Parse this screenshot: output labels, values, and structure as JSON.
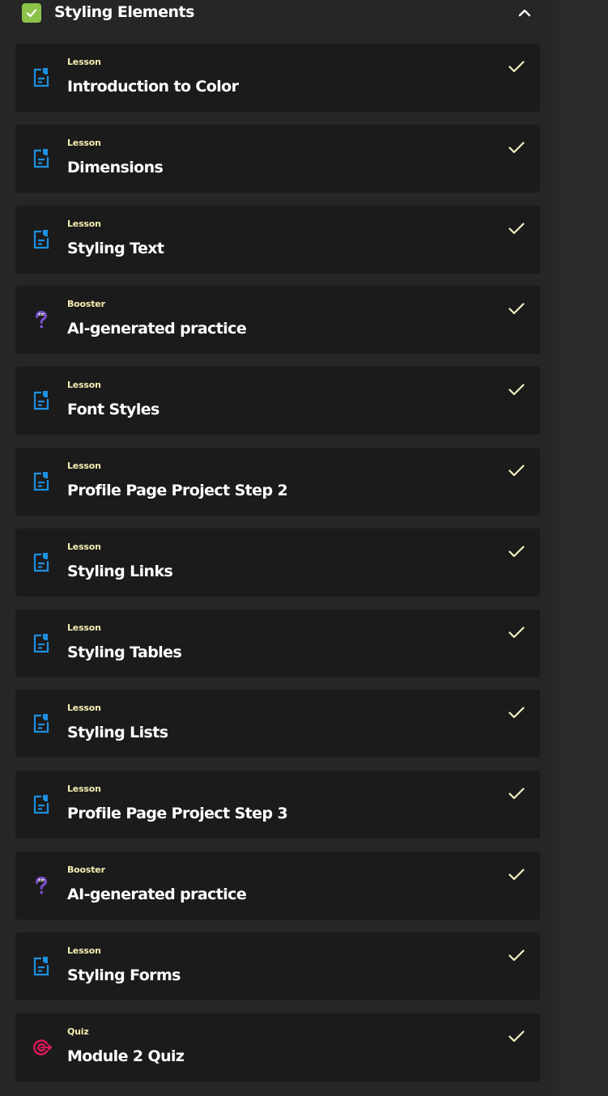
{
  "module": {
    "title": "Styling Elements",
    "completed": true,
    "collapse_icon": "chevron-up-icon",
    "accent_color": "#8bc34a"
  },
  "colors": {
    "lesson_icon": "#1e90e0",
    "booster_icon": "#7b4fd0",
    "quiz_icon": "#e0195a",
    "type_label": "#f5eeb0",
    "check": "#f5f0c0"
  },
  "items": [
    {
      "type": "Lesson",
      "title": "Introduction to Color",
      "icon": "lesson-icon",
      "completed": true
    },
    {
      "type": "Lesson",
      "title": "Dimensions",
      "icon": "lesson-icon",
      "completed": true
    },
    {
      "type": "Lesson",
      "title": "Styling Text",
      "icon": "lesson-icon",
      "completed": true
    },
    {
      "type": "Booster",
      "title": "AI-generated practice",
      "icon": "booster-icon",
      "completed": true
    },
    {
      "type": "Lesson",
      "title": "Font Styles",
      "icon": "lesson-icon",
      "completed": true
    },
    {
      "type": "Lesson",
      "title": "Profile Page Project Step 2",
      "icon": "lesson-icon",
      "completed": true
    },
    {
      "type": "Lesson",
      "title": "Styling Links",
      "icon": "lesson-icon",
      "completed": true
    },
    {
      "type": "Lesson",
      "title": "Styling Tables",
      "icon": "lesson-icon",
      "completed": true
    },
    {
      "type": "Lesson",
      "title": "Styling Lists",
      "icon": "lesson-icon",
      "completed": true
    },
    {
      "type": "Lesson",
      "title": "Profile Page Project Step 3",
      "icon": "lesson-icon",
      "completed": true
    },
    {
      "type": "Booster",
      "title": "AI-generated practice",
      "icon": "booster-icon",
      "completed": true
    },
    {
      "type": "Lesson",
      "title": "Styling Forms",
      "icon": "lesson-icon",
      "completed": true
    },
    {
      "type": "Quiz",
      "title": "Module 2 Quiz",
      "icon": "quiz-icon",
      "completed": true
    }
  ]
}
